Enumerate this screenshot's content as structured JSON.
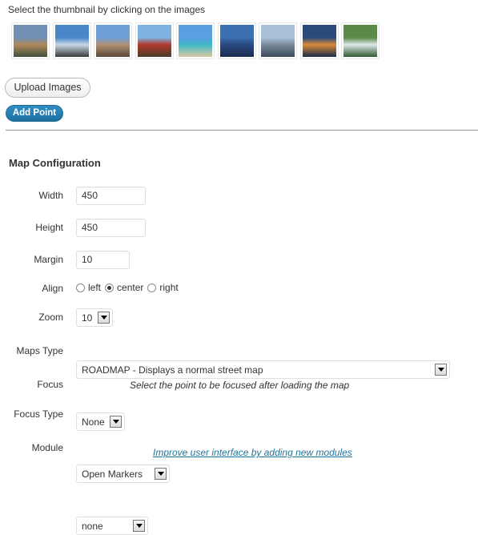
{
  "hint": "Select the thumbnail by clicking on the images",
  "thumbnails": [
    {
      "name": "thumbnail-canal-city",
      "icon": "photo-icon",
      "colors": [
        "#6f8fb3",
        "#b08a5c",
        "#3f4f3b"
      ]
    },
    {
      "name": "thumbnail-domed-building",
      "icon": "photo-icon",
      "colors": [
        "#4a86c8",
        "#c9d7e6",
        "#3a3a3a"
      ]
    },
    {
      "name": "thumbnail-city-square",
      "icon": "photo-icon",
      "colors": [
        "#6fa0d8",
        "#b09070",
        "#5c4a38"
      ]
    },
    {
      "name": "thumbnail-pagoda",
      "icon": "photo-icon",
      "colors": [
        "#7fb2e0",
        "#b23a2a",
        "#4a3a2a"
      ]
    },
    {
      "name": "thumbnail-beach",
      "icon": "photo-icon",
      "colors": [
        "#5aa0e0",
        "#3fb8c8",
        "#d8c9a0"
      ]
    },
    {
      "name": "thumbnail-skyscrapers",
      "icon": "photo-icon",
      "colors": [
        "#3a6fb0",
        "#2a4a80",
        "#1a2a50"
      ]
    },
    {
      "name": "thumbnail-venice-gondolas",
      "icon": "photo-icon",
      "colors": [
        "#a8c0d8",
        "#7a8a9a",
        "#3a4a5a"
      ]
    },
    {
      "name": "thumbnail-sunset-harbor",
      "icon": "photo-icon",
      "colors": [
        "#2a4a7a",
        "#d88a3a",
        "#1a2a4a"
      ]
    },
    {
      "name": "thumbnail-hillside-garden",
      "icon": "photo-icon",
      "colors": [
        "#5a8a4a",
        "#dfe8ea",
        "#2f5a30"
      ]
    }
  ],
  "buttons": {
    "upload": "Upload Images",
    "add_point": "Add Point"
  },
  "section_title": "Map Configuration",
  "fields": {
    "width": {
      "label": "Width",
      "value": "450"
    },
    "height": {
      "label": "Height",
      "value": "450"
    },
    "margin": {
      "label": "Margin",
      "value": "10"
    },
    "align": {
      "label": "Align",
      "options": [
        "left",
        "center",
        "right"
      ],
      "selected": "center"
    },
    "zoom": {
      "label": "Zoom",
      "value": "10"
    },
    "maps_type": {
      "label": "Maps Type",
      "value": "ROADMAP - Displays a normal street map"
    },
    "focus": {
      "label": "Focus",
      "value": "None",
      "note": "Select the point to be focused after loading the map"
    },
    "focus_type": {
      "label": "Focus Type",
      "value": "Open Markers"
    },
    "module": {
      "label": "Module",
      "value": "none",
      "link": "Improve user interface by adding new modules"
    }
  },
  "colors": {
    "accent": "#21759b",
    "button_primary": "#2577a8",
    "divider": "#999999"
  }
}
